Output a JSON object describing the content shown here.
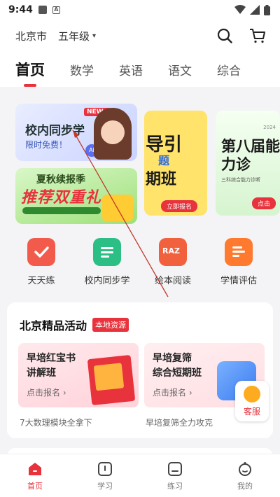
{
  "status_bar": {
    "time": "9:44"
  },
  "header": {
    "city": "北京市",
    "grade": "五年级"
  },
  "tabs": [
    {
      "label": "首页",
      "active": true
    },
    {
      "label": "数学",
      "active": false
    },
    {
      "label": "英语",
      "active": false
    },
    {
      "label": "语文",
      "active": false
    },
    {
      "label": "综合",
      "active": false
    }
  ],
  "banners": {
    "sync": {
      "title": "校内同步学",
      "subtitle": "限时免费！",
      "badge": "NEW !",
      "ai": "AI"
    },
    "summer": {
      "title": "夏秋续报季",
      "slogan": "推荐双重礼"
    },
    "guide": {
      "line1": "导引",
      "line2": "题",
      "line3": "期班",
      "button": "立即报名"
    },
    "contest": {
      "title": "第八届能力诊",
      "year": "2024",
      "sub": "三科综合能力诊断",
      "button": "点击"
    }
  },
  "quick_links": [
    {
      "label": "天天练",
      "icon": "daily-practice-icon",
      "color": "#f25b4b"
    },
    {
      "label": "校内同步学",
      "icon": "sync-learning-icon",
      "color": "#2bbf85"
    },
    {
      "label": "绘本阅读",
      "icon": "raz-reading-icon",
      "color": "#f1613d",
      "badge": "RAZ"
    },
    {
      "label": "学情评估",
      "icon": "assessment-icon",
      "color": "#ff7a2e"
    }
  ],
  "activities": {
    "title": "北京精品活动",
    "tag": "本地资源",
    "items": [
      {
        "title_line1": "早培红宝书",
        "title_line2": "讲解班",
        "cta": "点击报名 ›",
        "desc": "7大数理模块全拿下"
      },
      {
        "title_line1": "早培复筛",
        "title_line2": "综合短期班",
        "cta": "点击报名 ›",
        "desc": "早培复筛全力攻克"
      }
    ]
  },
  "customer_service": {
    "label": "客服"
  },
  "bottom_nav": [
    {
      "label": "首页",
      "icon": "home-icon",
      "active": true
    },
    {
      "label": "学习",
      "icon": "study-icon",
      "active": false
    },
    {
      "label": "练习",
      "icon": "practice-icon",
      "active": false
    },
    {
      "label": "我的",
      "icon": "profile-icon",
      "active": false
    }
  ],
  "colors": {
    "accent": "#e8323c",
    "background": "#f4f4f6"
  }
}
